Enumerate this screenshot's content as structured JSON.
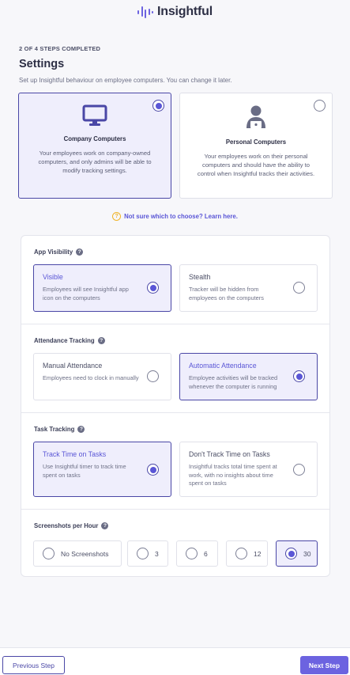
{
  "brand": {
    "name": "Insightful",
    "accent": "#6c63e0"
  },
  "progress": "2 OF 4 STEPS COMPLETED",
  "page": {
    "title": "Settings",
    "subtitle": "Set up Insightful behaviour on employee computers. You can change it later."
  },
  "computer_type": {
    "options": [
      {
        "title": "Company Computers",
        "description": "Your employees work on company-owned computers, and only admins will be able to modify tracking settings.",
        "selected": true,
        "icon": "monitor-icon"
      },
      {
        "title": "Personal Computers",
        "description": "Your employees work on their personal computers and should have the ability to control when Insightful tracks their activities.",
        "selected": false,
        "icon": "person-laptop-icon"
      }
    ]
  },
  "help_link": "Not sure which to choose? Learn here.",
  "app_visibility": {
    "title": "App Visibility",
    "options": [
      {
        "title": "Visible",
        "description": "Employees will see Insightful app icon on the computers",
        "selected": true
      },
      {
        "title": "Stealth",
        "description": "Tracker will be hidden from employees on the computers",
        "selected": false
      }
    ]
  },
  "attendance_tracking": {
    "title": "Attendance Tracking",
    "options": [
      {
        "title": "Manual Attendance",
        "description": "Employees need to clock in manually",
        "selected": false
      },
      {
        "title": "Automatic Attendance",
        "description": "Employee activities will be tracked whenever the computer is running",
        "selected": true
      }
    ]
  },
  "task_tracking": {
    "title": "Task Tracking",
    "options": [
      {
        "title": "Track Time on Tasks",
        "description": "Use Insightful timer to track time spent on tasks",
        "selected": true
      },
      {
        "title": "Don't Track Time on Tasks",
        "description": "Insightful tracks total time spent at work, with no insights about time spent on tasks",
        "selected": false
      }
    ]
  },
  "screenshots": {
    "title": "Screenshots per Hour",
    "options": [
      "No Screenshots",
      "3",
      "6",
      "12",
      "30"
    ],
    "selected": "30"
  },
  "footer": {
    "previous_label": "Previous Step",
    "next_label": "Next Step"
  }
}
